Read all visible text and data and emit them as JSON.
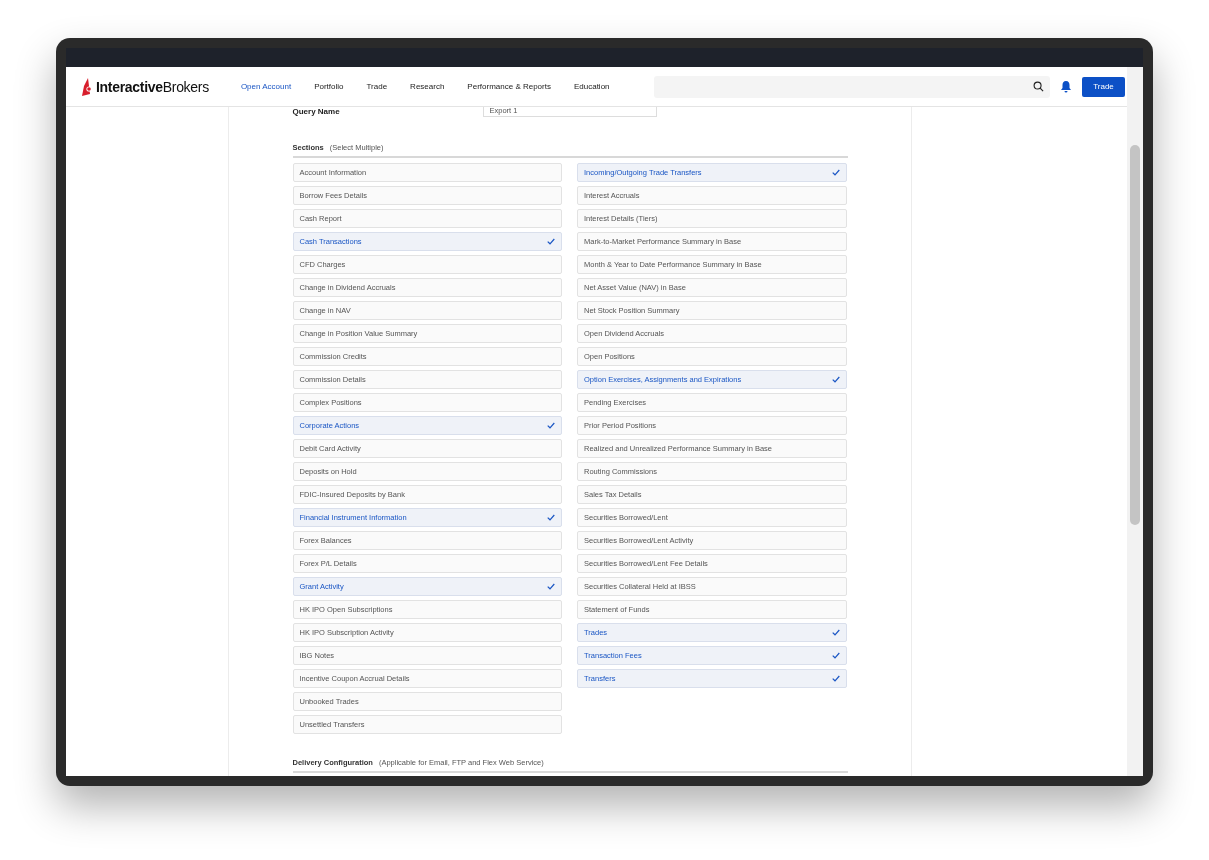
{
  "brand": {
    "name_bold": "Interactive",
    "name_light": "Brokers"
  },
  "nav": [
    {
      "label": "Open Account",
      "selected": true
    },
    {
      "label": "Portfolio",
      "selected": false
    },
    {
      "label": "Trade",
      "selected": false
    },
    {
      "label": "Research",
      "selected": false
    },
    {
      "label": "Performance & Reports",
      "selected": false
    },
    {
      "label": "Education",
      "selected": false
    }
  ],
  "trade_button": "Trade",
  "query": {
    "label": "Query Name",
    "value": "Export 1"
  },
  "sections": {
    "title": "Sections",
    "hint": "(Select Multiple)",
    "columns": [
      [
        {
          "label": "Account Information",
          "checked": false
        },
        {
          "label": "Borrow Fees Details",
          "checked": false
        },
        {
          "label": "Cash Report",
          "checked": false
        },
        {
          "label": "Cash Transactions",
          "checked": true
        },
        {
          "label": "CFD Charges",
          "checked": false
        },
        {
          "label": "Change in Dividend Accruals",
          "checked": false
        },
        {
          "label": "Change in NAV",
          "checked": false
        },
        {
          "label": "Change in Position Value Summary",
          "checked": false
        },
        {
          "label": "Commission Credits",
          "checked": false
        },
        {
          "label": "Commission Details",
          "checked": false
        },
        {
          "label": "Complex Positions",
          "checked": false
        },
        {
          "label": "Corporate Actions",
          "checked": true
        },
        {
          "label": "Debit Card Activity",
          "checked": false
        },
        {
          "label": "Deposits on Hold",
          "checked": false
        },
        {
          "label": "FDIC-Insured Deposits by Bank",
          "checked": false
        },
        {
          "label": "Financial Instrument Information",
          "checked": true
        },
        {
          "label": "Forex Balances",
          "checked": false
        },
        {
          "label": "Forex P/L Details",
          "checked": false
        },
        {
          "label": "Grant Activity",
          "checked": true
        },
        {
          "label": "HK IPO Open Subscriptions",
          "checked": false
        },
        {
          "label": "HK IPO Subscription Activity",
          "checked": false
        },
        {
          "label": "IBG Notes",
          "checked": false
        },
        {
          "label": "Incentive Coupon Accrual Details",
          "checked": false
        },
        {
          "label": "Unbooked Trades",
          "checked": false
        },
        {
          "label": "Unsettled Transfers",
          "checked": false
        }
      ],
      [
        {
          "label": "Incoming/Outgoing Trade Transfers",
          "checked": true
        },
        {
          "label": "Interest Accruals",
          "checked": false
        },
        {
          "label": "Interest Details (Tiers)",
          "checked": false
        },
        {
          "label": "Mark-to-Market Performance Summary in Base",
          "checked": false
        },
        {
          "label": "Month & Year to Date Performance Summary in Base",
          "checked": false
        },
        {
          "label": "Net Asset Value (NAV) in Base",
          "checked": false
        },
        {
          "label": "Net Stock Position Summary",
          "checked": false
        },
        {
          "label": "Open Dividend Accruals",
          "checked": false
        },
        {
          "label": "Open Positions",
          "checked": false
        },
        {
          "label": "Option Exercises, Assignments and Expirations",
          "checked": true
        },
        {
          "label": "Pending Exercises",
          "checked": false
        },
        {
          "label": "Prior Period Positions",
          "checked": false
        },
        {
          "label": "Realized and Unrealized Performance Summary in Base",
          "checked": false
        },
        {
          "label": "Routing Commissions",
          "checked": false
        },
        {
          "label": "Sales Tax Details",
          "checked": false
        },
        {
          "label": "Securities Borrowed/Lent",
          "checked": false
        },
        {
          "label": "Securities Borrowed/Lent Activity",
          "checked": false
        },
        {
          "label": "Securities Borrowed/Lent Fee Details",
          "checked": false
        },
        {
          "label": "Securities Collateral Held at IBSS",
          "checked": false
        },
        {
          "label": "Statement of Funds",
          "checked": false
        },
        {
          "label": "Trades",
          "checked": true
        },
        {
          "label": "Transaction Fees",
          "checked": true
        },
        {
          "label": "Transfers",
          "checked": true
        }
      ]
    ]
  },
  "delivery": {
    "title": "Delivery Configuration",
    "hint": "(Applicable for Email, FTP and Flex Web Service)"
  }
}
